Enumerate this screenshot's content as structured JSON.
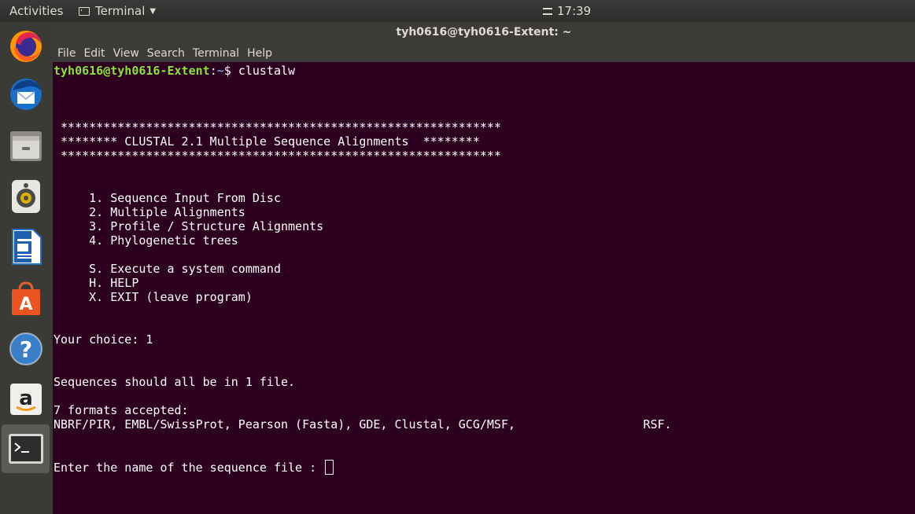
{
  "topbar": {
    "activities": "Activities",
    "app_name": "Terminal",
    "clock": "17:39"
  },
  "dock": {
    "items": [
      "Firefox",
      "Thunderbird",
      "Files",
      "Rhythmbox",
      "LibreOffice Writer",
      "Ubuntu Software",
      "Help",
      "Amazon",
      "Terminal"
    ]
  },
  "window": {
    "title": "tyh0616@tyh0616-Extent: ~"
  },
  "menubar": {
    "items": [
      "File",
      "Edit",
      "View",
      "Search",
      "Terminal",
      "Help"
    ]
  },
  "terminal": {
    "prompt_user": "tyh0616@tyh0616-Extent",
    "prompt_sep": ":",
    "prompt_path": "~",
    "prompt_end": "$ ",
    "command": "clustalw",
    "lines": [
      " **************************************************************",
      " ******** CLUSTAL 2.1 Multiple Sequence Alignments  ********",
      " **************************************************************",
      "     1. Sequence Input From Disc",
      "     2. Multiple Alignments",
      "     3. Profile / Structure Alignments",
      "     4. Phylogenetic trees",
      "     S. Execute a system command",
      "     H. HELP",
      "     X. EXIT (leave program)",
      "Your choice: 1",
      "Sequences should all be in 1 file.",
      "7 formats accepted:",
      "NBRF/PIR, EMBL/SwissProt, Pearson (Fasta), GDE, Clustal, GCG/MSF,                  RSF.",
      "Enter the name of the sequence file : "
    ]
  },
  "colors": {
    "terminal_bg": "#2c001e",
    "prompt_user": "#8ae234",
    "prompt_path": "#729fcf",
    "accent": "#e95420"
  }
}
